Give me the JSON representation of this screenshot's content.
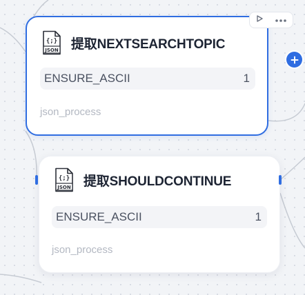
{
  "canvas": {
    "background": "#f2f4f7",
    "accent_color": "#2f6de1"
  },
  "toolbar": {
    "run_icon": "play-icon",
    "more_icon": "more-icon"
  },
  "nodes": [
    {
      "icon": "json-file-icon",
      "icon_label": "JSON",
      "title": "提取NEXTSEARCHTOPIC",
      "param": {
        "name": "ENSURE_ASCII",
        "value": "1"
      },
      "footer": "json_process",
      "selected": true
    },
    {
      "icon": "json-file-icon",
      "icon_label": "JSON",
      "title": "提取SHOULDCONTINUE",
      "param": {
        "name": "ENSURE_ASCII",
        "value": "1"
      },
      "footer": "json_process",
      "selected": false
    }
  ]
}
